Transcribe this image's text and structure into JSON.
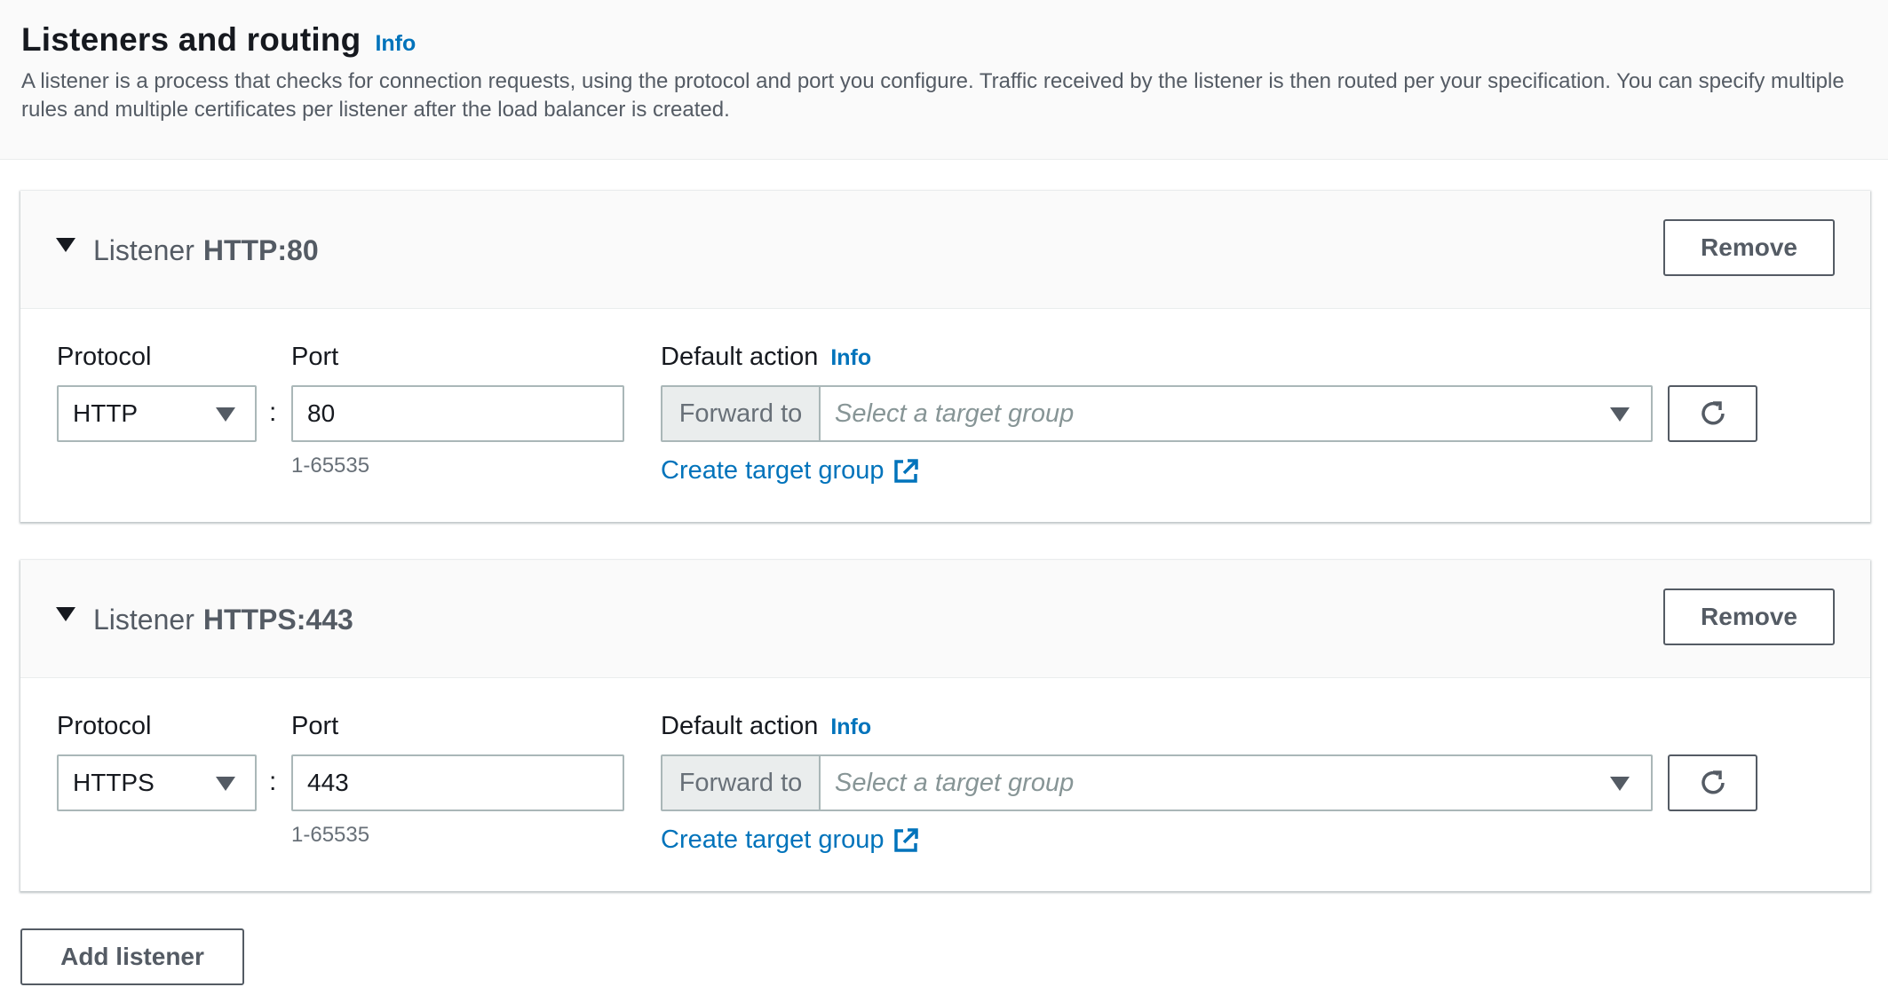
{
  "header": {
    "title": "Listeners and routing",
    "info": "Info",
    "description": "A listener is a process that checks for connection requests, using the protocol and port you configure. Traffic received by the listener is then routed per your specification. You can specify multiple rules and multiple certificates per listener after the load balancer is created."
  },
  "listeners": [
    {
      "prefix": "Listener",
      "name": "HTTP:80",
      "remove_label": "Remove",
      "protocol_label": "Protocol",
      "protocol_value": "HTTP",
      "colon": ":",
      "port_label": "Port",
      "port_value": "80",
      "port_hint": "1-65535",
      "default_action_label": "Default action",
      "info": "Info",
      "forward_label": "Forward to",
      "target_placeholder": "Select a target group",
      "create_link": "Create target group"
    },
    {
      "prefix": "Listener",
      "name": "HTTPS:443",
      "remove_label": "Remove",
      "protocol_label": "Protocol",
      "protocol_value": "HTTPS",
      "colon": ":",
      "port_label": "Port",
      "port_value": "443",
      "port_hint": "1-65535",
      "default_action_label": "Default action",
      "info": "Info",
      "forward_label": "Forward to",
      "target_placeholder": "Select a target group",
      "create_link": "Create target group"
    }
  ],
  "footer": {
    "add_listener_label": "Add listener"
  },
  "colors": {
    "link": "#0073bb",
    "text": "#16191f",
    "secondary": "#545b64",
    "border": "#aab7b8"
  },
  "icons": [
    "caret-down-icon",
    "dropdown-arrow-icon",
    "external-link-icon",
    "refresh-icon"
  ]
}
